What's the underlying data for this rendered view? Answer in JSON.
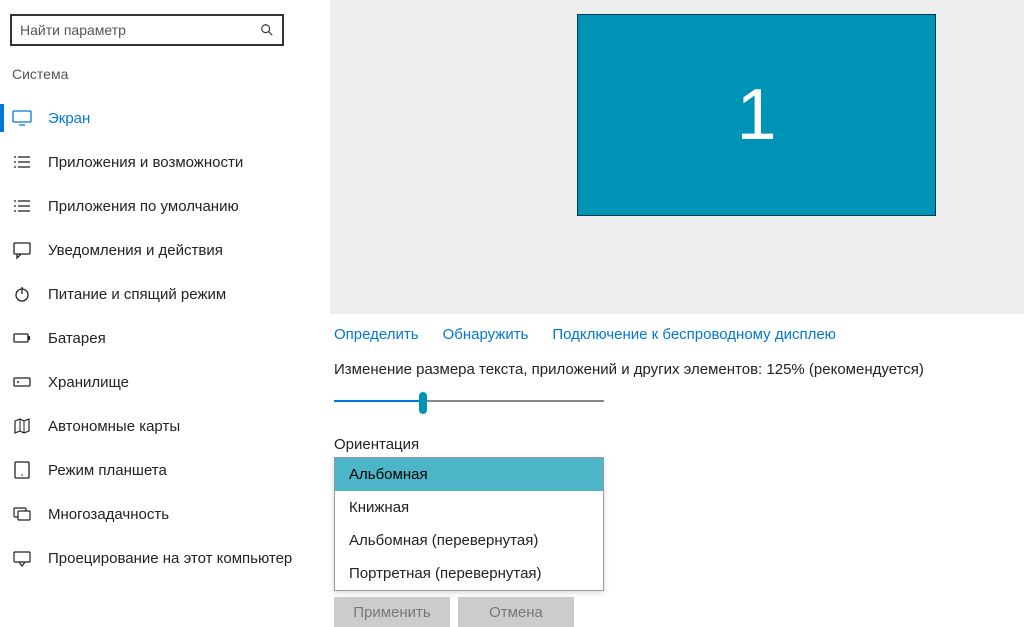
{
  "search": {
    "placeholder": "Найти параметр"
  },
  "section_title": "Система",
  "sidebar": {
    "items": [
      {
        "label": "Экран"
      },
      {
        "label": "Приложения и возможности"
      },
      {
        "label": "Приложения по умолчанию"
      },
      {
        "label": "Уведомления и действия"
      },
      {
        "label": "Питание и спящий режим"
      },
      {
        "label": "Батарея"
      },
      {
        "label": "Хранилище"
      },
      {
        "label": "Автономные карты"
      },
      {
        "label": "Режим планшета"
      },
      {
        "label": "Многозадачность"
      },
      {
        "label": "Проецирование на этот компьютер"
      }
    ]
  },
  "monitor_number": "1",
  "links": {
    "identify": "Определить",
    "detect": "Обнаружить",
    "wireless": "Подключение к беспроводному дисплею"
  },
  "scale_text": "Изменение размера текста, приложений и других элементов: 125% (рекомендуется)",
  "orientation": {
    "label": "Ориентация",
    "options": [
      "Альбомная",
      "Книжная",
      "Альбомная (перевернутая)",
      "Портретная (перевернутая)"
    ]
  },
  "buttons": {
    "apply": "Применить",
    "cancel": "Отмена"
  }
}
